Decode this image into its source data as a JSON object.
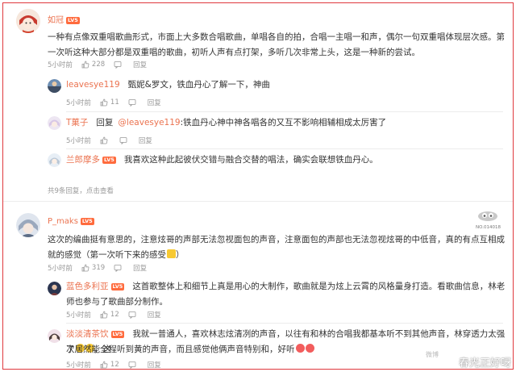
{
  "badge_label": "LV5",
  "threads": [
    {
      "user": "如冠",
      "text": "一种有点像双重唱歌曲形式，市面上大多数合唱歌曲，单唱各自的拍，合唱一主唱一和声，偶尔一句双重唱体现层次感。第一次听这种大部分都是双重唱的歌曲，初听人声有点打架，多听几次非常上头，这是一种新的尝试。",
      "time": "5小时前",
      "likes": "228",
      "reply_label": "回复",
      "replies": [
        {
          "user": "leavesye119",
          "text": "甄妮&罗文，铁血丹心了解一下，神曲",
          "time": "5小时前",
          "likes": "11",
          "reply_label": "回复"
        },
        {
          "user": "T菓子",
          "reply_prefix": "回复",
          "mention": "@leavesye119",
          "text": ":铁血丹心神中神各唱各的又互不影响相辅相成太厉害了",
          "time": "5小时前",
          "likes": "",
          "reply_label": "回复"
        },
        {
          "user": "兰郎摩多",
          "text": "我喜欢这种此起彼伏交错与融合交替的唱法，确实会联想铁血丹心。"
        }
      ],
      "more": "共9条回复，点击查看"
    },
    {
      "user": "P_maks",
      "medal_text": "NO.014018",
      "text": "这次的编曲挺有意思的，注意炫哥的声部无法忽视面包的声音，注意面包的声部也无法忽视炫哥的中低音，真的有点互相成就的感觉（第一次听下来的感受",
      "time": "5小时前",
      "likes": "319",
      "reply_label": "回复",
      "replies": [
        {
          "user": "蓝色多利亚",
          "text": "这首歌整体上和细节上真是用心的大制作，歌曲就是为炫上云霄的风格量身打造。看歌曲信息，林老师也参与了歌曲部分制作。",
          "time": "5小时前",
          "likes": "12",
          "reply_label": "回复"
        },
        {
          "user": "淡淡清茶饮",
          "text": "我就一普通人，喜欢林志炫清冽的声音，以往有和林的合唱我都基本听不到其他声音，林穿透力太强了",
          "text_line2": "次居然能全程听到黄的声音，而且感觉他俩声音特别和，好听",
          "time": "5小时前",
          "likes": "12",
          "reply_label": "回复"
        }
      ]
    }
  ],
  "watermark": "春光正好呀",
  "watermark_sub": "微博",
  "colors": {
    "name": "#eb7350",
    "border": "#e0393e",
    "badge": "#ff6b3d",
    "meta": "#999999"
  }
}
